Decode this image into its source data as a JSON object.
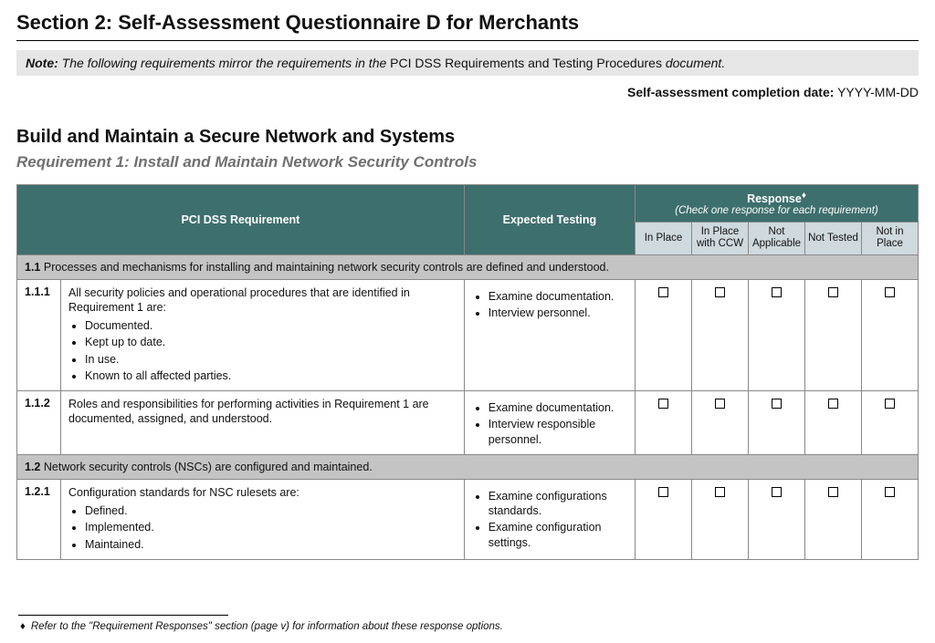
{
  "section_title": "Section 2: Self-Assessment Questionnaire D for Merchants",
  "note": {
    "label": "Note:",
    "text_before": "The following requirements mirror the requirements in the ",
    "middle_plain": "PCI DSS Requirements and Testing Procedures",
    "text_after": " document."
  },
  "completion": {
    "label": "Self-assessment completion date:",
    "value": "YYYY-MM-DD"
  },
  "category_title": "Build and Maintain a Secure Network and Systems",
  "requirement_title": "Requirement 1: Install and Maintain Network Security Controls",
  "headers": {
    "col_req": "PCI DSS Requirement",
    "col_test": "Expected Testing",
    "col_resp": "Response",
    "col_resp_dagger": "♦",
    "col_resp_sub": "(Check one response for each requirement)",
    "resp_options": [
      "In Place",
      "In Place with CCW",
      "Not Applicable",
      "Not Tested",
      "Not in Place"
    ]
  },
  "groups": [
    {
      "id": "1.1",
      "text": "Processes and mechanisms for installing and maintaining network security controls are defined and understood."
    },
    {
      "id": "1.2",
      "text": "Network security controls (NSCs) are configured and maintained."
    }
  ],
  "rows": [
    {
      "id": "1.1.1",
      "req_intro": "All security policies and operational procedures that are identified in Requirement 1 are:",
      "req_bullets": [
        "Documented.",
        "Kept up to date.",
        "In use.",
        "Known to all affected parties."
      ],
      "test_bullets": [
        "Examine documentation.",
        "Interview personnel."
      ]
    },
    {
      "id": "1.1.2",
      "req_intro": "Roles and responsibilities for performing activities in Requirement 1 are documented, assigned, and understood.",
      "req_bullets": [],
      "test_bullets": [
        "Examine documentation.",
        "Interview responsible personnel."
      ]
    },
    {
      "id": "1.2.1",
      "req_intro": "Configuration standards for NSC rulesets are:",
      "req_bullets": [
        "Defined.",
        "Implemented.",
        "Maintained."
      ],
      "test_bullets": [
        "Examine configurations standards.",
        "Examine configuration settings."
      ]
    }
  ],
  "footnote": {
    "marker": "♦",
    "text": "Refer to the \"Requirement Responses\" section (page v) for information about these response options."
  }
}
